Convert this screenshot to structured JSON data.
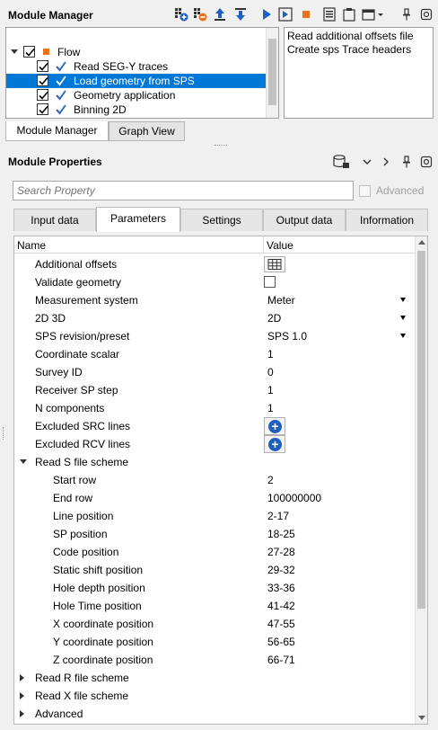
{
  "module_manager": {
    "title": "Module Manager",
    "toolbar_icons": [
      "add-module-icon",
      "remove-module-icon",
      "move-up-icon",
      "move-down-icon",
      "run-icon",
      "run-step-icon",
      "stop-icon",
      "list-icon",
      "clipboard-icon",
      "window-dropdown-icon",
      "pin-icon",
      "close-icon"
    ],
    "tree": [
      {
        "label": "Flow",
        "level": 0,
        "checked": true,
        "selected": false
      },
      {
        "label": "Read SEG-Y traces",
        "level": 1,
        "checked": true,
        "selected": false
      },
      {
        "label": "Load geometry from SPS",
        "level": 1,
        "checked": true,
        "selected": true
      },
      {
        "label": "Geometry application",
        "level": 1,
        "checked": true,
        "selected": false
      },
      {
        "label": "Binning 2D",
        "level": 1,
        "checked": true,
        "selected": false
      }
    ],
    "description_lines": [
      "Read additional offsets file",
      "Create sps Trace headers"
    ],
    "tabs": [
      {
        "label": "Module Manager",
        "active": true
      },
      {
        "label": "Graph View",
        "active": false
      }
    ]
  },
  "module_properties": {
    "title": "Module Properties",
    "search_placeholder": "Search Property",
    "advanced_label": "Advanced",
    "tabs": [
      {
        "label": "Input data",
        "active": false
      },
      {
        "label": "Parameters",
        "active": true
      },
      {
        "label": "Settings",
        "active": false
      },
      {
        "label": "Output data",
        "active": false
      },
      {
        "label": "Information",
        "active": false
      }
    ],
    "columns": {
      "name": "Name",
      "value": "Value"
    },
    "rows": [
      {
        "name": "Additional offsets",
        "indent": 1,
        "kind": "table-button",
        "value": ""
      },
      {
        "name": "Validate geometry",
        "indent": 1,
        "kind": "checkbox",
        "value": ""
      },
      {
        "name": "Measurement system",
        "indent": 1,
        "kind": "dropdown",
        "value": "Meter"
      },
      {
        "name": "2D 3D",
        "indent": 1,
        "kind": "dropdown",
        "value": "2D"
      },
      {
        "name": "SPS revision/preset",
        "indent": 1,
        "kind": "dropdown",
        "value": "SPS 1.0"
      },
      {
        "name": "Coordinate scalar",
        "indent": 1,
        "kind": "text",
        "value": "1"
      },
      {
        "name": "Survey ID",
        "indent": 1,
        "kind": "text",
        "value": "0"
      },
      {
        "name": "Receiver SP step",
        "indent": 1,
        "kind": "text",
        "value": "1"
      },
      {
        "name": "N components",
        "indent": 1,
        "kind": "text",
        "value": "1"
      },
      {
        "name": "Excluded SRC lines",
        "indent": 1,
        "kind": "plus-button",
        "value": ""
      },
      {
        "name": "Excluded RCV lines",
        "indent": 1,
        "kind": "plus-button",
        "value": ""
      },
      {
        "name": "Read S file scheme",
        "indent": 1,
        "kind": "group-open",
        "value": ""
      },
      {
        "name": "Start row",
        "indent": 2,
        "kind": "text",
        "value": "2"
      },
      {
        "name": "End row",
        "indent": 2,
        "kind": "text",
        "value": "100000000"
      },
      {
        "name": "Line position",
        "indent": 2,
        "kind": "text",
        "value": "2-17"
      },
      {
        "name": "SP position",
        "indent": 2,
        "kind": "text",
        "value": "18-25"
      },
      {
        "name": "Code position",
        "indent": 2,
        "kind": "text",
        "value": "27-28"
      },
      {
        "name": "Static shift position",
        "indent": 2,
        "kind": "text",
        "value": "29-32"
      },
      {
        "name": "Hole depth position",
        "indent": 2,
        "kind": "text",
        "value": "33-36"
      },
      {
        "name": "Hole Time position",
        "indent": 2,
        "kind": "text",
        "value": "41-42"
      },
      {
        "name": "X coordinate position",
        "indent": 2,
        "kind": "text",
        "value": "47-55"
      },
      {
        "name": "Y coordinate position",
        "indent": 2,
        "kind": "text",
        "value": "56-65"
      },
      {
        "name": "Z coordinate position",
        "indent": 2,
        "kind": "text",
        "value": "66-71"
      },
      {
        "name": "Read R file scheme",
        "indent": 1,
        "kind": "group-closed",
        "value": ""
      },
      {
        "name": "Read X file scheme",
        "indent": 1,
        "kind": "group-closed",
        "value": ""
      },
      {
        "name": "Advanced",
        "indent": 1,
        "kind": "group-closed",
        "value": ""
      }
    ]
  },
  "colors": {
    "selection": "#0078d7",
    "accent_blue": "#1f5fbf",
    "stop_orange": "#e8731a",
    "flow_square": "#e8731a"
  }
}
